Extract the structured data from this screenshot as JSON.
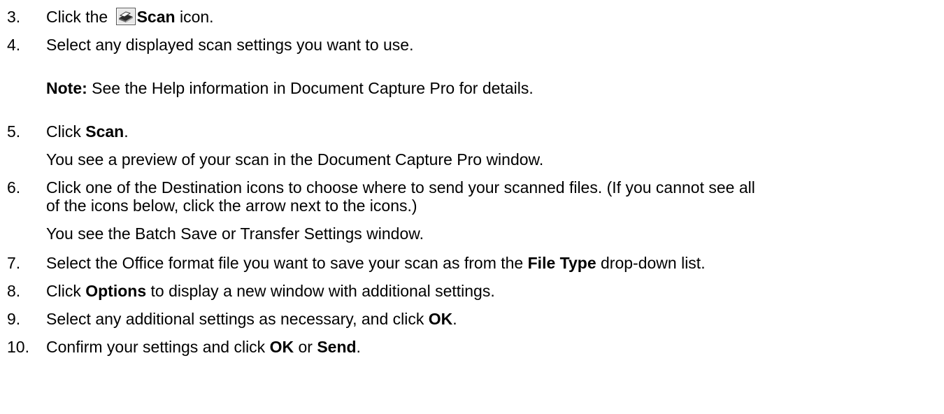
{
  "steps": [
    {
      "num": "3.",
      "parts": [
        "Click the ",
        "Scan",
        " icon."
      ],
      "icon": "scanner-icon"
    },
    {
      "num": "4.",
      "parts": [
        "Select any displayed scan settings you want to use."
      ]
    },
    {
      "note": {
        "label": "Note:",
        "text": " See the Help information in Document Capture Pro for details."
      }
    },
    {
      "num": "5.",
      "parts": [
        "Click ",
        "Scan",
        "."
      ]
    },
    {
      "sub": "You see a preview of your scan in the Document Capture Pro window."
    },
    {
      "num": "6.",
      "parts": [
        "Click one of the Destination icons to choose where to send your scanned files. (If you cannot see all",
        "of the icons below, click the arrow next to the icons.)"
      ]
    },
    {
      "sub": "You see the Batch Save or Transfer Settings window."
    },
    {
      "num": "7.",
      "parts": [
        "Select the Office format file you want to save your scan as from the ",
        "File Type",
        " drop-down list."
      ]
    },
    {
      "num": "8.",
      "parts": [
        "Click ",
        "Options",
        " to display a new window with additional settings."
      ]
    },
    {
      "num": "9.",
      "parts": [
        "Select any additional settings as necessary, and click ",
        "OK",
        "."
      ]
    },
    {
      "num": "10.",
      "parts": [
        "Confirm your settings and click ",
        "OK",
        " or ",
        "Send",
        "."
      ]
    }
  ],
  "colors": {
    "text": "#000000",
    "background": "#ffffff"
  }
}
